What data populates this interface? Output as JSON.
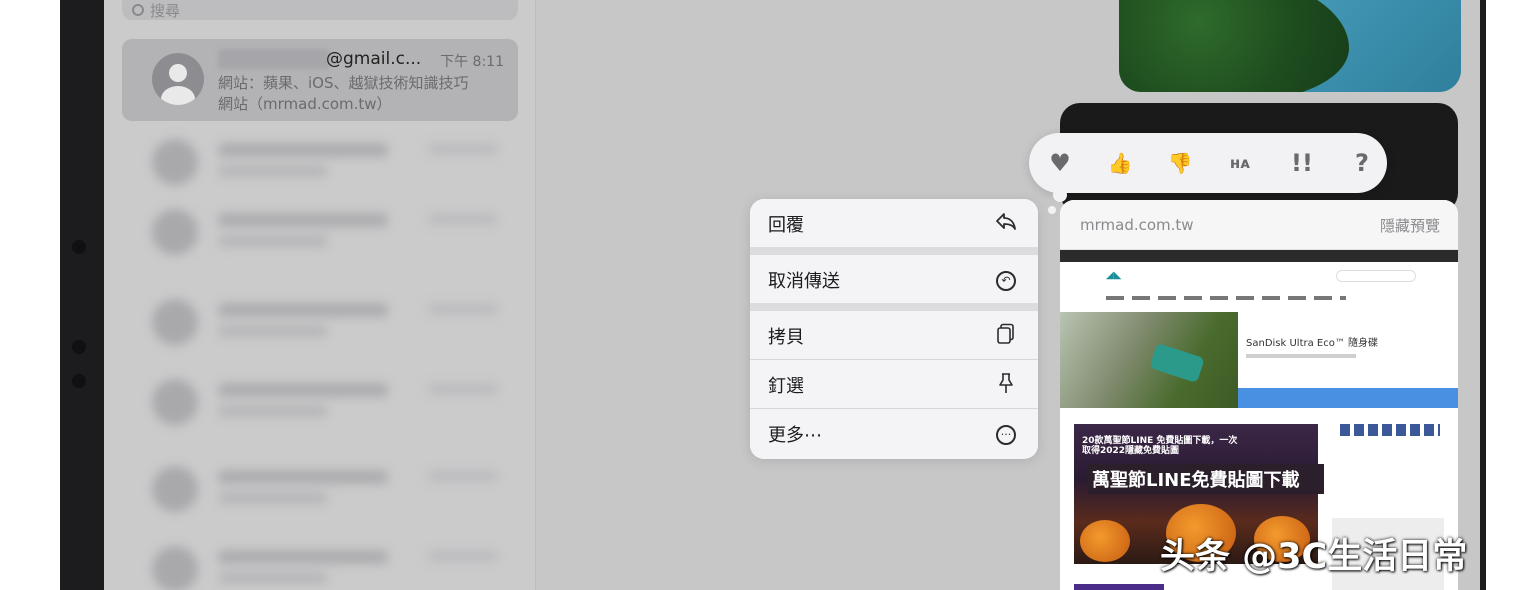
{
  "sidebar": {
    "search_placeholder": "搜尋",
    "selected_conversation": {
      "sender": "@gmail.c...",
      "time": "下午 8:11",
      "preview_line1": "網站：蘋果、iOS、越獄技術知識技巧",
      "preview_line2": "網站（mrmad.com.tw）"
    }
  },
  "tapbacks": [
    {
      "icon": "heart-icon",
      "glyph": "♥"
    },
    {
      "icon": "thumbs-up-icon",
      "glyph": "👍"
    },
    {
      "icon": "thumbs-down-icon",
      "glyph": "👎"
    },
    {
      "icon": "haha-icon",
      "glyph": "ʜᴀ"
    },
    {
      "icon": "exclamation-icon",
      "glyph": "!!"
    },
    {
      "icon": "question-icon",
      "glyph": "?"
    }
  ],
  "context_menu": {
    "reply": "回覆",
    "undo_send": "取消傳送",
    "copy": "拷貝",
    "pin": "釘選",
    "more": "更多⋯"
  },
  "link_preview": {
    "domain": "mrmad.com.tw",
    "hide_preview": "隱藏預覽",
    "ad_title": "SanDisk Ultra Eco™ 隨身碟",
    "article_headline": "20款萬聖節LINE 免費貼圖下載，一次取得2022隱藏免費貼圖",
    "article_banner": "萬聖節LINE免費貼圖下載"
  },
  "watermark": "头条 @3C生活日常"
}
